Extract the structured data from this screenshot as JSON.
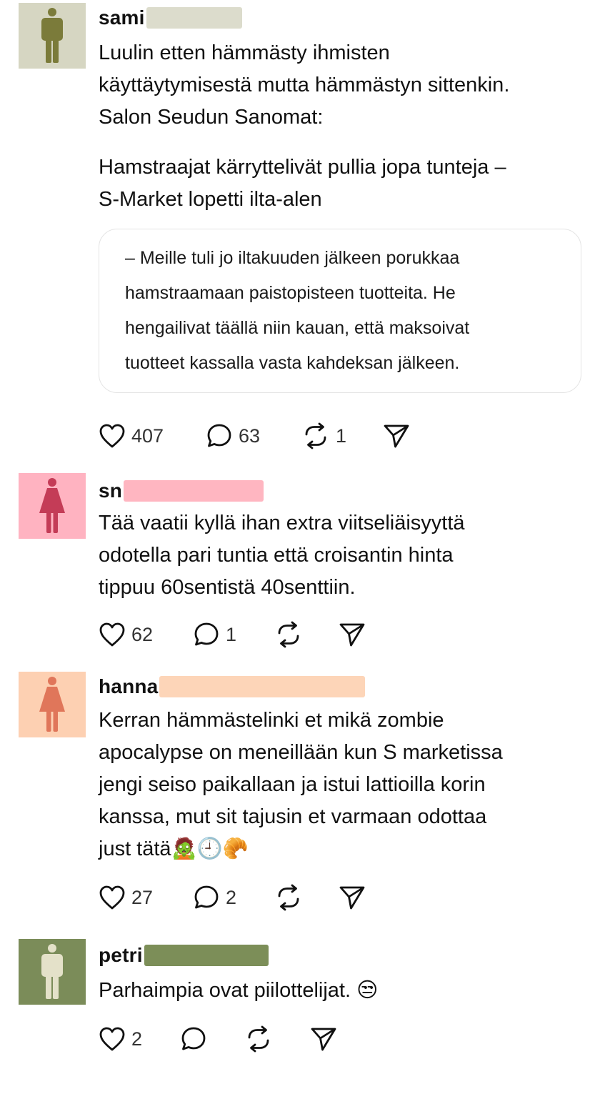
{
  "posts": [
    {
      "username": "sami",
      "avatar": {
        "bg": "#d6d6c2",
        "figure": "#7b7b3a",
        "gender": "male",
        "icon": "person-icon"
      },
      "redaction_color": "#dcdccc",
      "text": "Luulin etten hämmästy ihmisten\nkäyttäytymisestä mutta hämmästyn sittenkin.\nSalon Seudun Sanomat:",
      "headline": "Hamstraajat kärryttelivät pullia jopa tunteja –\nS-Market lopetti ilta-alen",
      "quote": "– Meille tuli jo iltakuuden jälkeen porukkaa\nhamstraamaan paistopisteen tuotteita. He\nhengailivat täällä niin kauan, että maksoivat\ntuotteet kassalla vasta kahdeksan jälkeen.",
      "likes": "407",
      "replies": "63",
      "reposts": "1"
    },
    {
      "username": "sn",
      "avatar": {
        "bg": "#ffb3c1",
        "figure": "#c43c57",
        "gender": "female",
        "icon": "person-icon"
      },
      "redaction_color": "#ffb6c1",
      "text": "Tää vaatii kyllä ihan extra viitseliäisyyttä\nodotella pari tuntia että croisantin hinta\ntippuu 60sentistä 40senttiin.",
      "likes": "62",
      "replies": "1",
      "reposts": ""
    },
    {
      "username": "hanna",
      "avatar": {
        "bg": "#fdd0b2",
        "figure": "#e0765a",
        "gender": "female",
        "icon": "person-icon"
      },
      "redaction_color": "#fdd5b8",
      "text": "Kerran hämmästelinki et mikä zombie\napocalypse on meneillään kun S marketissa\njengi seiso paikallaan ja istui lattioilla korin\nkanssa, mut sit tajusin et varmaan odottaa\njust tätä",
      "emojis": [
        "🧟",
        "🕘",
        "🥐"
      ],
      "likes": "27",
      "replies": "2",
      "reposts": ""
    },
    {
      "username": "petri",
      "avatar": {
        "bg": "#7b8c59",
        "figure": "#e4e1c9",
        "gender": "male",
        "icon": "person-icon"
      },
      "redaction_color": "#7c8e58",
      "text": "Parhaimpia ovat piilottelijat.",
      "emojis": [
        "😒"
      ],
      "likes": "2",
      "replies": "",
      "reposts": ""
    }
  ],
  "icons": {
    "like": "heart-icon",
    "reply": "speech-bubble-icon",
    "repost": "repost-icon",
    "share": "send-icon"
  }
}
